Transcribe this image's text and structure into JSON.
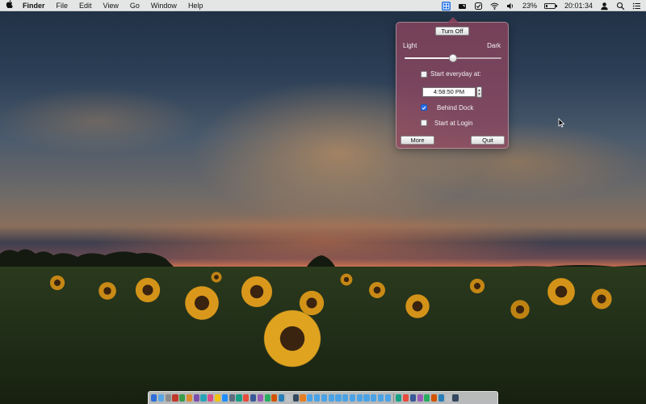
{
  "menubar": {
    "apple_icon": "apple-logo-icon",
    "app_name": "Finder",
    "menus": [
      "File",
      "Edit",
      "View",
      "Go",
      "Window",
      "Help"
    ],
    "status_icons": [
      "night-shift-app-icon",
      "night-display-icon",
      "task-check-icon",
      "wifi-icon",
      "volume-icon"
    ],
    "battery_percent": "23%",
    "battery_level": 0.23,
    "clock": "20:01:34",
    "right_icons": [
      "user-icon",
      "spotlight-search-icon",
      "notification-center-icon"
    ]
  },
  "popover": {
    "turn_off_label": "Turn Off",
    "light_label": "Light",
    "dark_label": "Dark",
    "slider_value": 0.5,
    "start_everyday_label": "Start everyday at:",
    "start_everyday_checked": false,
    "time_value": "4:58:50 PM",
    "behind_dock_label": "Behind Dock",
    "behind_dock_checked": true,
    "start_at_login_label": "Start at Login",
    "start_at_login_checked": false,
    "more_label": "More",
    "quit_label": "Quit"
  },
  "colors": {
    "popover_bg": "#96465f",
    "menubar_bg": "#ececec",
    "accent": "#2a6ee8"
  },
  "dock": {
    "icon_count": 43
  }
}
